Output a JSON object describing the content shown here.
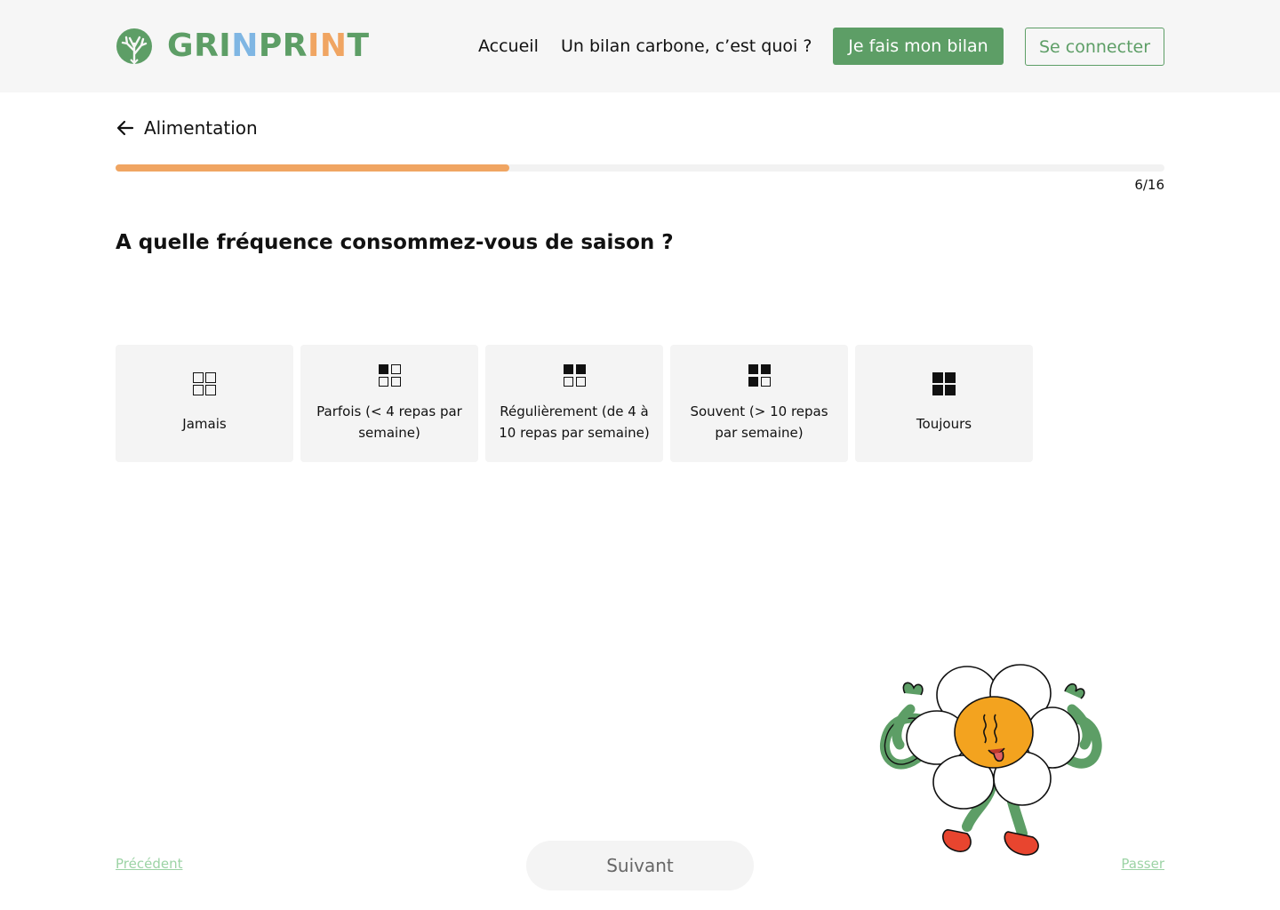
{
  "brand": {
    "letters": [
      {
        "ch": "G",
        "color": "#5d9e66"
      },
      {
        "ch": "R",
        "color": "#5d9e66"
      },
      {
        "ch": "I",
        "color": "#5d9e66"
      },
      {
        "ch": "N",
        "color": "#7fb6e3"
      },
      {
        "ch": "P",
        "color": "#5d9e66"
      },
      {
        "ch": "R",
        "color": "#5d9e66"
      },
      {
        "ch": "I",
        "color": "#f0a562"
      },
      {
        "ch": "N",
        "color": "#f0a562"
      },
      {
        "ch": "T",
        "color": "#5d9e66"
      }
    ],
    "name": "GRINPRINT",
    "mark_icon": "tree-leaf-icon",
    "mark_color": "#5d9e66"
  },
  "nav": {
    "home_label": "Accueil",
    "what_label": "Un bilan carbone, c’est quoi ?",
    "cta_label": "Je fais mon bilan",
    "login_label": "Se connecter"
  },
  "section": {
    "back_icon": "arrow-left-icon",
    "title": "Alimentation"
  },
  "progress": {
    "current": 6,
    "total": 16,
    "fraction": 0.333,
    "text": "6/16",
    "fill_color": "#f0a562"
  },
  "question": {
    "text": "A quelle fréquence consommez-vous de saison ?"
  },
  "options": [
    {
      "label": "Jamais",
      "level": 0,
      "icon": "grid-empty-icon"
    },
    {
      "label": "Parfois (< 4 repas par semaine)",
      "level": 1,
      "icon": "grid-quarter-icon"
    },
    {
      "label": "Régulièrement (de 4 à 10 repas par semaine)",
      "level": 2,
      "icon": "grid-half-icon"
    },
    {
      "label": "Souvent (> 10 repas par semaine)",
      "level": 3,
      "icon": "grid-three-quarter-icon"
    },
    {
      "label": "Toujours",
      "level": 4,
      "icon": "grid-full-icon"
    }
  ],
  "footer": {
    "prev_label": "Précédent",
    "next_label": "Suivant",
    "skip_label": "Passer"
  },
  "colors": {
    "brand_green": "#5d9e66",
    "link_disabled": "#9cd3a5",
    "accent_orange": "#f0a562"
  },
  "illustration": {
    "icon": "daisy-mascot-icon"
  }
}
